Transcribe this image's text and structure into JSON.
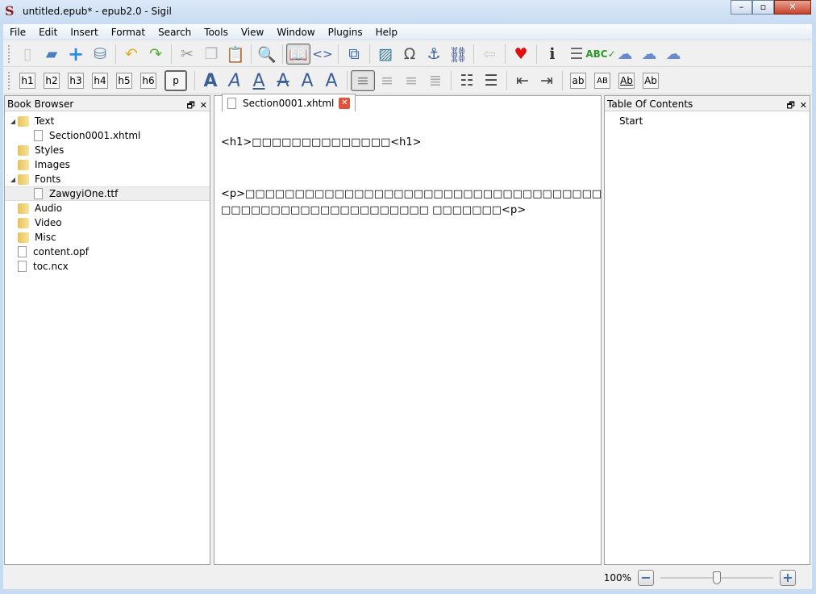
{
  "window": {
    "title": "untitled.epub* - epub2.0 - Sigil",
    "app_icon": "S"
  },
  "menu": [
    "File",
    "Edit",
    "Insert",
    "Format",
    "Search",
    "Tools",
    "View",
    "Window",
    "Plugins",
    "Help"
  ],
  "toolbar": {
    "headings": [
      "h1",
      "h2",
      "h3",
      "h4",
      "h5",
      "h6",
      "p"
    ],
    "text_styles": [
      "A",
      "A",
      "A",
      "A",
      "A",
      "A"
    ],
    "case_buttons": [
      "ab",
      "AB",
      "Ab",
      "Ab"
    ],
    "code_view": "<>"
  },
  "book_browser": {
    "title": "Book Browser",
    "items": [
      {
        "label": "Text",
        "type": "folder",
        "expanded": true,
        "level": 0
      },
      {
        "label": "Section0001.xhtml",
        "type": "file",
        "level": 1
      },
      {
        "label": "Styles",
        "type": "folder",
        "level": 0
      },
      {
        "label": "Images",
        "type": "folder",
        "level": 0
      },
      {
        "label": "Fonts",
        "type": "folder",
        "expanded": true,
        "level": 0
      },
      {
        "label": "ZawgyiOne.ttf",
        "type": "font",
        "level": 1,
        "selected": true
      },
      {
        "label": "Audio",
        "type": "folder",
        "level": 0
      },
      {
        "label": "Video",
        "type": "folder",
        "level": 0
      },
      {
        "label": "Misc",
        "type": "folder",
        "level": 0
      },
      {
        "label": "content.opf",
        "type": "file",
        "level": 0
      },
      {
        "label": "toc.ncx",
        "type": "file",
        "level": 0
      }
    ]
  },
  "editor": {
    "tab": "Section0001.xhtml",
    "lines": [
      "<h1>□□□□□□□□□□□□□□<h1>",
      "<p>□□□□□□□□□□□□□□□□□□□□□□□□□□□□□□□□□□□□□□□□",
      "□□□□□□□□□□□□□□□□□□□□□ □□□□□□□<p>"
    ]
  },
  "toc": {
    "title": "Table Of Contents",
    "items": [
      "Start"
    ]
  },
  "status": {
    "zoom": "100%",
    "zoom_fraction": 0.5
  }
}
